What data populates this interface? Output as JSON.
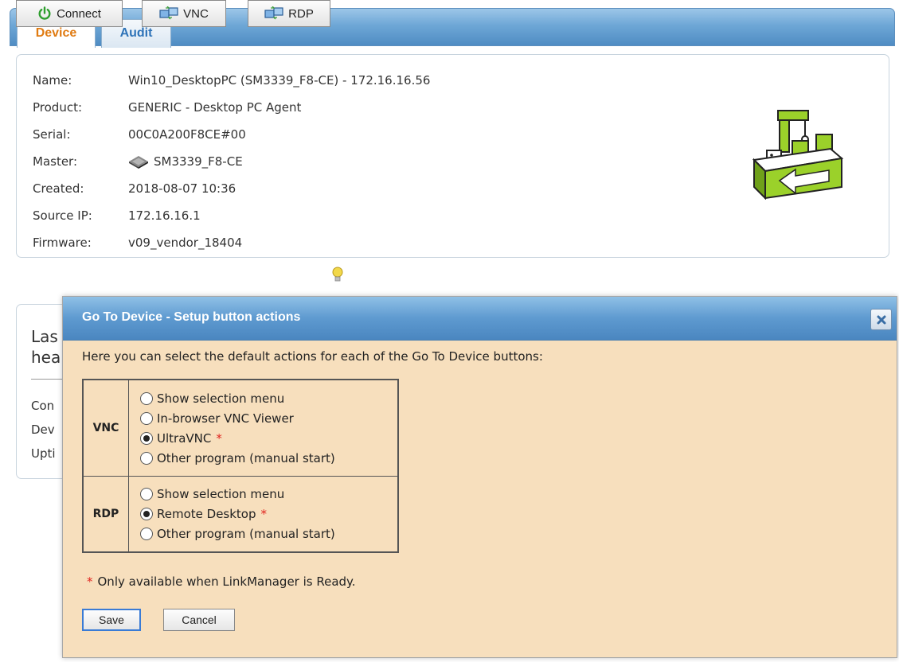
{
  "tabs": [
    {
      "label": "Device",
      "active": true
    },
    {
      "label": "Audit",
      "active": false
    }
  ],
  "device": {
    "fields": [
      {
        "label": "Name:",
        "value": "Win10_DesktopPC (SM3339_F8-CE) - 172.16.16.56"
      },
      {
        "label": "Product:",
        "value": "GENERIC - Desktop PC Agent"
      },
      {
        "label": "Serial:",
        "value": "00C0A200F8CE#00"
      },
      {
        "label": "Master:",
        "value": "SM3339_F8-CE",
        "icon": "device-chip-icon"
      },
      {
        "label": "Created:",
        "value": "2018-08-07 10:36"
      },
      {
        "label": "Source IP:",
        "value": "172.16.16.1"
      },
      {
        "label": "Firmware:",
        "value": "v09_vendor_18404"
      }
    ],
    "product_icon": "conveyor-belt-icon"
  },
  "actions": {
    "connect_label": "Connect",
    "vnc_label": "VNC",
    "rdp_label": "RDP",
    "colors": {
      "connect_icon": "#2e9e2e",
      "bulb": "#f2d84a"
    }
  },
  "background_panel": {
    "line1": "Las",
    "line2": "hea",
    "row1": "Con",
    "row2": "Dev",
    "row3": "Upti"
  },
  "dialog": {
    "title": "Go To Device - Setup button actions",
    "intro": "Here you can select the default actions for each of the Go To Device buttons:",
    "groups": [
      {
        "name": "VNC",
        "options": [
          {
            "label": "Show selection menu",
            "selected": false,
            "star": false
          },
          {
            "label": "In-browser VNC Viewer",
            "selected": false,
            "star": false
          },
          {
            "label": "UltraVNC",
            "selected": true,
            "star": true
          },
          {
            "label": "Other program (manual start)",
            "selected": false,
            "star": false
          }
        ]
      },
      {
        "name": "RDP",
        "options": [
          {
            "label": "Show selection menu",
            "selected": false,
            "star": false
          },
          {
            "label": "Remote Desktop",
            "selected": true,
            "star": true
          },
          {
            "label": "Other program (manual start)",
            "selected": false,
            "star": false
          }
        ]
      }
    ],
    "star_symbol": "*",
    "footnote": "Only available when LinkManager is Ready.",
    "save_label": "Save",
    "cancel_label": "Cancel",
    "colors": {
      "background": "#f7dfbd",
      "header": "#5e9ad0",
      "star": "#e0231e"
    }
  }
}
